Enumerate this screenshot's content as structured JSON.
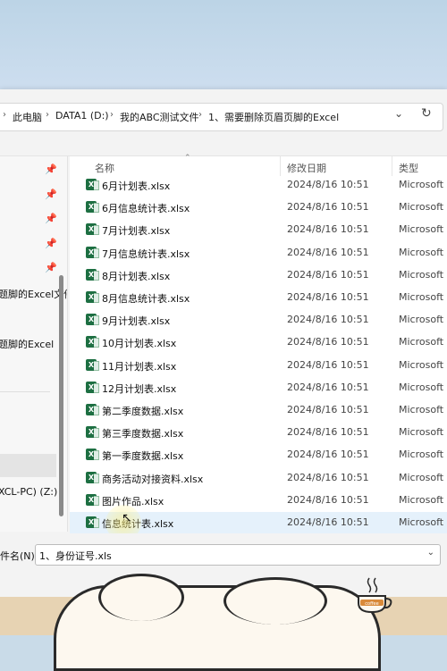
{
  "address": {
    "crumbs": [
      "此电脑",
      "DATA1 (D:)",
      "我的ABC测试文件",
      "1、需要删除页眉页脚的Excel"
    ],
    "separator": "›",
    "dropdown_icon": "chevron-down-icon",
    "refresh_icon": "refresh-icon"
  },
  "nav": {
    "items": [
      "题脚的Excel文件",
      "题脚的Excel",
      "XCL-PC) (Z:)"
    ],
    "pin_icon": "pin-icon"
  },
  "columns": {
    "name": "名称",
    "modified": "修改日期",
    "type": "类型"
  },
  "files": [
    {
      "name": "6月计划表.xlsx",
      "date": "2024/8/16 10:51",
      "type": "Microsoft E"
    },
    {
      "name": "6月信息统计表.xlsx",
      "date": "2024/8/16 10:51",
      "type": "Microsoft E"
    },
    {
      "name": "7月计划表.xlsx",
      "date": "2024/8/16 10:51",
      "type": "Microsoft E"
    },
    {
      "name": "7月信息统计表.xlsx",
      "date": "2024/8/16 10:51",
      "type": "Microsoft E"
    },
    {
      "name": "8月计划表.xlsx",
      "date": "2024/8/16 10:51",
      "type": "Microsoft E"
    },
    {
      "name": "8月信息统计表.xlsx",
      "date": "2024/8/16 10:51",
      "type": "Microsoft E"
    },
    {
      "name": "9月计划表.xlsx",
      "date": "2024/8/16 10:51",
      "type": "Microsoft E"
    },
    {
      "name": "10月计划表.xlsx",
      "date": "2024/8/16 10:51",
      "type": "Microsoft E"
    },
    {
      "name": "11月计划表.xlsx",
      "date": "2024/8/16 10:51",
      "type": "Microsoft E"
    },
    {
      "name": "12月计划表.xlsx",
      "date": "2024/8/16 10:51",
      "type": "Microsoft E"
    },
    {
      "name": "第二季度数据.xlsx",
      "date": "2024/8/16 10:51",
      "type": "Microsoft E"
    },
    {
      "name": "第三季度数据.xlsx",
      "date": "2024/8/16 10:51",
      "type": "Microsoft E"
    },
    {
      "name": "第一季度数据.xlsx",
      "date": "2024/8/16 10:51",
      "type": "Microsoft E"
    },
    {
      "name": "商务活动对接资料.xlsx",
      "date": "2024/8/16 10:51",
      "type": "Microsoft E"
    },
    {
      "name": "图片作品.xlsx",
      "date": "2024/8/16 10:51",
      "type": "Microsoft E"
    },
    {
      "name": "信息统计表.xlsx",
      "date": "2024/8/16 10:51",
      "type": "Microsoft E"
    }
  ],
  "selected_index": 15,
  "filename": {
    "label": "件名(N):",
    "value": "1、身份证号.xls"
  },
  "decor": {
    "coffee_label": "coffee"
  },
  "colors": {
    "excel_green": "#1d6f42",
    "selection": "#e5f1fb"
  }
}
